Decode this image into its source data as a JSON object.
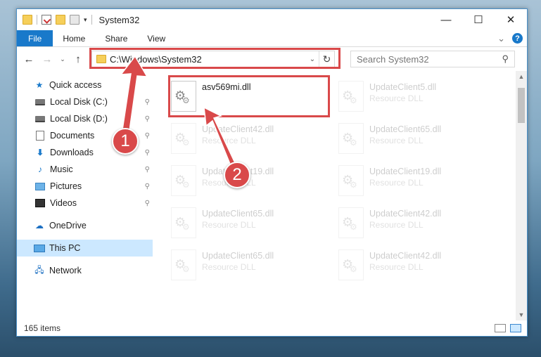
{
  "titlebar": {
    "title": "System32",
    "qat_dropdown": "▾",
    "minimize": "—",
    "maximize": "☐",
    "close": "✕"
  },
  "ribbon": {
    "tabs": [
      "File",
      "Home",
      "Share",
      "View"
    ],
    "expand": "⌄",
    "help": "?"
  },
  "navbar": {
    "back": "←",
    "forward": "→",
    "recent": "⌄",
    "up": "↑",
    "address": "C:\\Windows\\System32",
    "address_dropdown": "⌄",
    "refresh": "↻",
    "search_placeholder": "Search System32",
    "search_icon": "⚲"
  },
  "sidebar": {
    "quick_access": "Quick access",
    "items": [
      {
        "label": "Local Disk (C:)",
        "icon": "disk-icon"
      },
      {
        "label": "Local Disk (D:)",
        "icon": "disk-icon"
      },
      {
        "label": "Documents",
        "icon": "documents-icon"
      },
      {
        "label": "Downloads",
        "icon": "downloads-icon"
      },
      {
        "label": "Music",
        "icon": "music-icon"
      },
      {
        "label": "Pictures",
        "icon": "pictures-icon"
      },
      {
        "label": "Videos",
        "icon": "videos-icon"
      }
    ],
    "pin_glyph": "📌",
    "onedrive": "OneDrive",
    "this_pc": "This PC",
    "network": "Network"
  },
  "files": [
    {
      "name": "asv569mi.dll",
      "type": ""
    },
    {
      "name": "UpdateClient5.dll",
      "type": "Resource DLL"
    },
    {
      "name": "UpdateClient42.dll",
      "type": "Resource DLL"
    },
    {
      "name": "UpdateClient65.dll",
      "type": "Resource DLL"
    },
    {
      "name": "UpdateClient19.dll",
      "type": "Resource DLL"
    },
    {
      "name": "UpdateClient19.dll",
      "type": "Resource DLL"
    },
    {
      "name": "UpdateClient65.dll",
      "type": "Resource DLL"
    },
    {
      "name": "UpdateClient42.dll",
      "type": "Resource DLL"
    },
    {
      "name": "UpdateClient65.dll",
      "type": "Resource DLL"
    },
    {
      "name": "UpdateClient42.dll",
      "type": "Resource DLL"
    }
  ],
  "status": {
    "item_count": "165 items"
  },
  "annotations": {
    "step1": "1",
    "step2": "2",
    "color": "#d9494a"
  }
}
